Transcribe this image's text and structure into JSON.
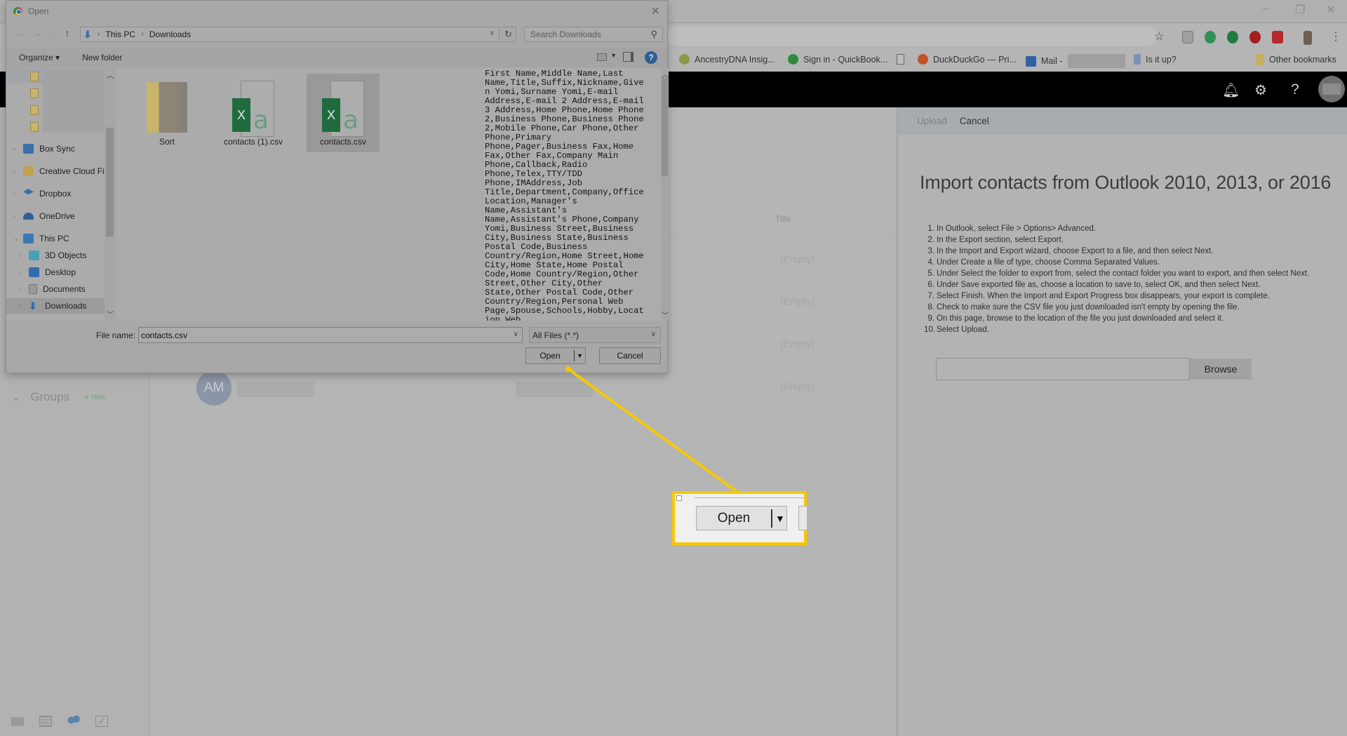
{
  "browser": {
    "window_controls": [
      "–",
      "❐",
      "✕"
    ],
    "toolbar_icons": [
      "star-icon",
      "page-icon",
      "grammarly-icon",
      "hangouts-icon",
      "opera-icon",
      "screencastify-icon",
      "profile-icon",
      "menu-icon"
    ],
    "bookmarks": [
      {
        "label": "AncestryDNA Insig...",
        "icon": "ancestry-icon",
        "color": "#8a9a4a"
      },
      {
        "label": "Sign in - QuickBook...",
        "icon": "quickbooks-icon",
        "color": "#2f8a3f"
      },
      {
        "label": "",
        "icon": "page-icon",
        "color": "#bdbdbd"
      },
      {
        "label": "DuckDuckGo — Pri...",
        "icon": "duckduckgo-icon",
        "color": "#c2512c"
      },
      {
        "label": "Mail -",
        "icon": "outlook-icon",
        "color": "#2f63a5"
      },
      {
        "label": "Is it up?",
        "icon": "wrench-icon",
        "color": "#7d8fb2"
      }
    ],
    "other_bookmarks": "Other bookmarks"
  },
  "outlook": {
    "header_icons": [
      "bell-icon",
      "gear-icon",
      "help-icon"
    ],
    "left_nav": {
      "groups_label": "Groups",
      "new_label": "New",
      "bottom_icons": [
        "mail-icon",
        "calendar-icon",
        "people-icon",
        "tasks-icon"
      ]
    },
    "list": {
      "column_title": "Title",
      "empty_values": [
        "(Empty)",
        "(Empty)",
        "(Empty)",
        "(Empty)"
      ],
      "contact_initials": "AM"
    },
    "import_panel": {
      "commands": {
        "upload": "Upload",
        "cancel": "Cancel"
      },
      "title": "Import contacts from Outlook 2010, 2013, or 2016",
      "steps": [
        {
          "num": "1.",
          "text": "In Outlook, select File > Options> Advanced."
        },
        {
          "num": "2.",
          "text": "In the Export section, select Export."
        },
        {
          "num": "3.",
          "text": "In the Import and Export wizard, choose Export to a file, and then select Next."
        },
        {
          "num": "4.",
          "text": "Under Create a file of type, choose Comma Separated Values."
        },
        {
          "num": "5.",
          "text": "Under Select the folder to export from, select the contact folder you want to export, and then select Next."
        },
        {
          "num": "6.",
          "text": "Under Save exported file as, choose a location to save to, select OK, and then select Next."
        },
        {
          "num": "7.",
          "text": "Select Finish. When the Import and Export Progress box disappears, your export is complete."
        },
        {
          "num": "8.",
          "text": "Check to make sure the CSV file you just downloaded isn't empty by opening the file."
        },
        {
          "num": "9.",
          "text": "On this page, browse to the location of the file you just downloaded and select it."
        },
        {
          "num": "10.",
          "text": "Select Upload."
        }
      ],
      "file_input_value": "",
      "browse_label": "Browse"
    }
  },
  "dialog": {
    "title": "Open",
    "close_label": "✕",
    "breadcrumb": [
      "This PC",
      "Downloads"
    ],
    "search_placeholder": "Search Downloads",
    "toolbar": {
      "organize": "Organize ▾",
      "new_folder": "New folder",
      "help": "?"
    },
    "tree": [
      {
        "label": "Box Sync",
        "icon": "box-icon",
        "color": "#3a6fa8",
        "expanded": false
      },
      {
        "label": "Creative Cloud Fil",
        "icon": "creative-cloud-icon",
        "color": "#c0a24f",
        "expanded": false
      },
      {
        "label": "Dropbox",
        "icon": "dropbox-icon",
        "color": "#3a6fa8",
        "expanded": false
      },
      {
        "label": "OneDrive",
        "icon": "onedrive-icon",
        "color": "#2f5f96",
        "expanded": false
      },
      {
        "label": "This PC",
        "icon": "computer-icon",
        "color": "#3a78b5",
        "expanded": true
      },
      {
        "label": "3D Objects",
        "icon": "3d-objects-icon",
        "color": "#4aa0b5",
        "expanded": false
      },
      {
        "label": "Desktop",
        "icon": "desktop-icon",
        "color": "#2f6fb0",
        "expanded": false
      },
      {
        "label": "Documents",
        "icon": "documents-icon",
        "color": "#9a9a9a",
        "expanded": false
      },
      {
        "label": "Downloads",
        "icon": "downloads-icon",
        "color": "#2f6fb0",
        "expanded": false,
        "selected": true
      }
    ],
    "files": [
      {
        "name": "Sort",
        "type": "folder"
      },
      {
        "name": "contacts (1).csv",
        "type": "csv"
      },
      {
        "name": "contacts.csv",
        "type": "csv",
        "selected": true
      }
    ],
    "preview_text": "First Name,Middle Name,Last\nName,Title,Suffix,Nickname,Give\nn Yomi,Surname Yomi,E-mail\nAddress,E-mail 2 Address,E-mail\n3 Address,Home Phone,Home Phone\n2,Business Phone,Business Phone\n2,Mobile Phone,Car Phone,Other\nPhone,Primary\nPhone,Pager,Business Fax,Home\nFax,Other Fax,Company Main\nPhone,Callback,Radio\nPhone,Telex,TTY/TDD\nPhone,IMAddress,Job\nTitle,Department,Company,Office\nLocation,Manager's\nName,Assistant's\nName,Assistant's Phone,Company\nYomi,Business Street,Business\nCity,Business State,Business\nPostal Code,Business\nCountry/Region,Home Street,Home\nCity,Home State,Home Postal\nCode,Home Country/Region,Other\nStreet,Other City,Other\nState,Other Postal Code,Other\nCountry/Region,Personal Web\nPage,Spouse,Schools,Hobby,Locat\nion Web",
    "file_name_label": "File name:",
    "file_name_value": "contacts.csv",
    "file_type": "All Files (*.*)",
    "open_label": "Open",
    "cancel_label": "Cancel"
  },
  "callout": {
    "open_label": "Open",
    "highlight_color": "#f6c900"
  }
}
